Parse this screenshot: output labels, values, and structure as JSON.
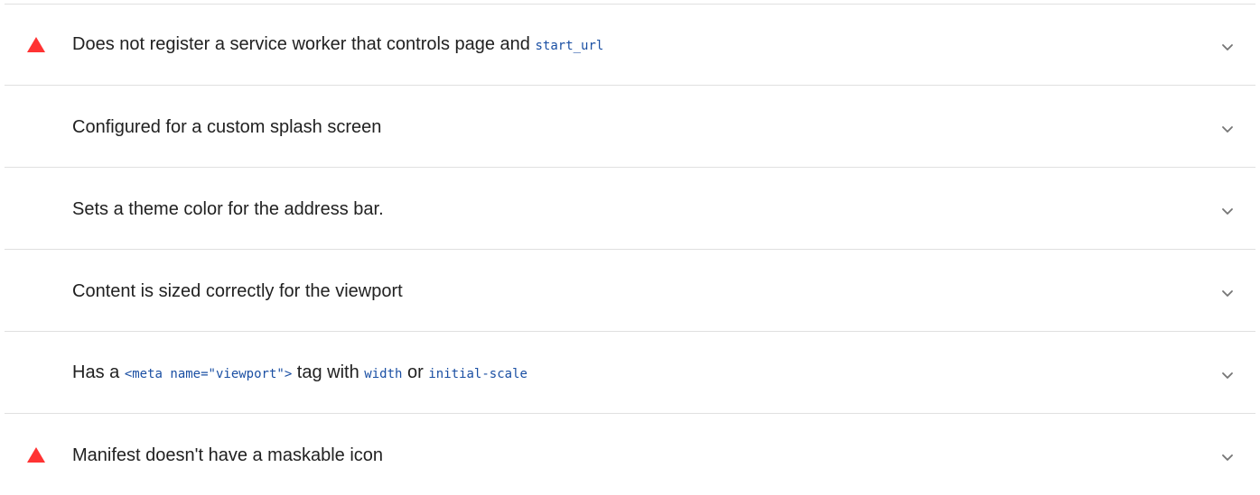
{
  "audits": [
    {
      "status": "fail",
      "parts": [
        {
          "text": "Does not register a service worker that controls page and ",
          "code": false
        },
        {
          "text": "start_url",
          "code": true
        }
      ]
    },
    {
      "status": "neutral",
      "parts": [
        {
          "text": "Configured for a custom splash screen",
          "code": false
        }
      ]
    },
    {
      "status": "neutral",
      "parts": [
        {
          "text": "Sets a theme color for the address bar.",
          "code": false
        }
      ]
    },
    {
      "status": "neutral",
      "parts": [
        {
          "text": "Content is sized correctly for the viewport",
          "code": false
        }
      ]
    },
    {
      "status": "neutral",
      "parts": [
        {
          "text": "Has a ",
          "code": false
        },
        {
          "text": "<meta name=\"viewport\">",
          "code": true
        },
        {
          "text": " tag with ",
          "code": false
        },
        {
          "text": "width",
          "code": true
        },
        {
          "text": " or ",
          "code": false
        },
        {
          "text": "initial-scale",
          "code": true
        }
      ]
    },
    {
      "status": "fail",
      "parts": [
        {
          "text": "Manifest doesn't have a maskable icon",
          "code": false
        }
      ]
    }
  ],
  "icons": {
    "fail": "warning-triangle-icon",
    "expand": "chevron-down-icon"
  },
  "colors": {
    "fail": "#ff3333",
    "code": "#1a4fa3",
    "text": "#212121",
    "divider": "#e0e0e0",
    "chevron": "#757575"
  }
}
